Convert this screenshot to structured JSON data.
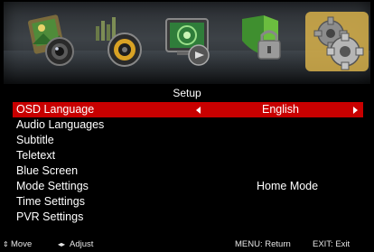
{
  "menu": {
    "icons": [
      {
        "name": "picture-icon"
      },
      {
        "name": "sound-icon"
      },
      {
        "name": "channel-icon"
      },
      {
        "name": "lock-icon"
      },
      {
        "name": "setup-gear-icon",
        "active": true
      }
    ]
  },
  "title": "Setup",
  "rows": [
    {
      "label": "OSD Language",
      "value": "English",
      "selected": true
    },
    {
      "label": "Audio Languages",
      "value": ""
    },
    {
      "label": "Subtitle",
      "value": ""
    },
    {
      "label": "Teletext",
      "value": ""
    },
    {
      "label": "Blue Screen",
      "value": ""
    },
    {
      "label": "Mode Settings",
      "value": "Home Mode"
    },
    {
      "label": "Time Settings",
      "value": ""
    },
    {
      "label": "PVR Settings",
      "value": ""
    }
  ],
  "footer": {
    "move_glyph": "⇕",
    "move_label": "Move",
    "adjust_glyph": "◂▸",
    "adjust_label": "Adjust",
    "menu_hint": "MENU: Return",
    "exit_hint": "EXIT: Exit"
  },
  "colors": {
    "highlight": "#c80000",
    "background": "#000000"
  }
}
